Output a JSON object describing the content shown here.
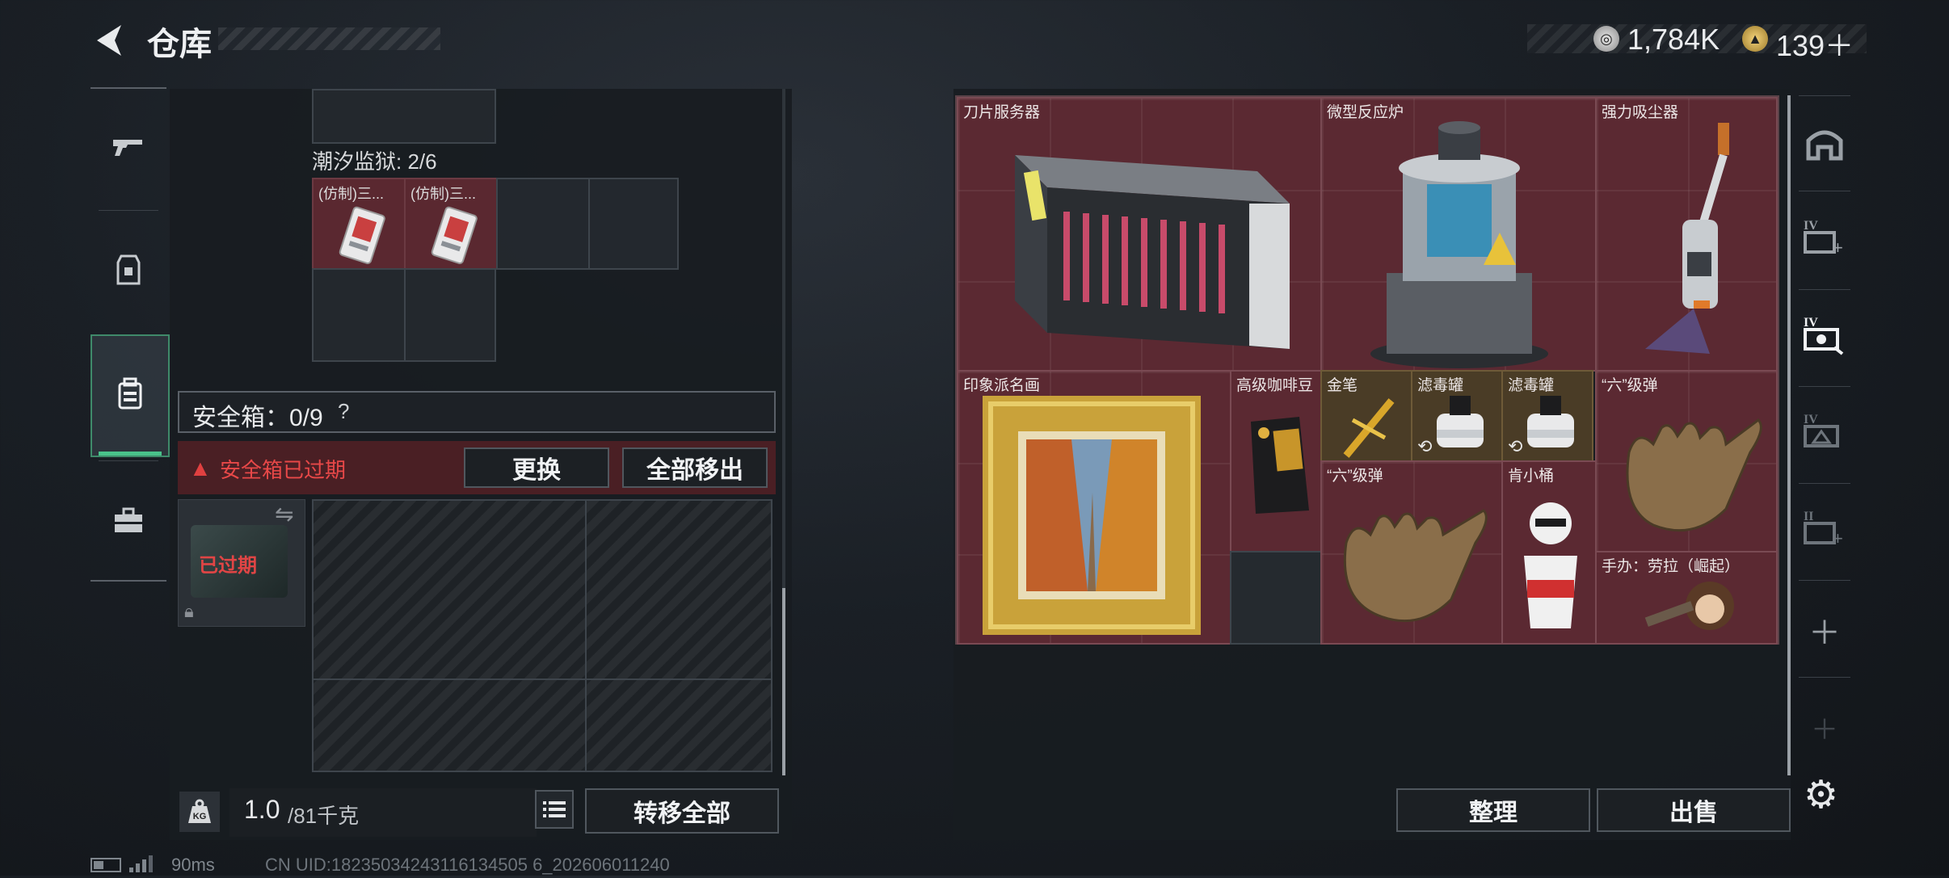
{
  "header": {
    "back_icon": "back-arrow-icon",
    "title": "仓库",
    "currency1": {
      "icon": "silver-coin-icon",
      "value": "1,784K"
    },
    "currency2": {
      "icon": "gold-coin-icon",
      "value": "139＋"
    }
  },
  "left_rail": {
    "tabs": [
      {
        "icon": "gun-icon",
        "active": false
      },
      {
        "icon": "armor-vest-icon",
        "active": false
      },
      {
        "icon": "backpack-icon",
        "active": true
      },
      {
        "icon": "toolbox-icon",
        "active": false
      }
    ]
  },
  "left_panel": {
    "prison_label": "潮汐监狱: 2/6",
    "prison_items": [
      {
        "caption": "(仿制)三...",
        "icon": "keycard-icon"
      },
      {
        "caption": "(仿制)三...",
        "icon": "keycard-icon"
      }
    ],
    "safe_box": {
      "label": "安全箱：0/9",
      "help": "?",
      "expired_text": "安全箱已过期",
      "replace_button": "更换",
      "move_all_button": "全部移出",
      "thumb_status": "已过期"
    },
    "weight": {
      "value": "1.0",
      "max": "/81千克",
      "icon": "weight-kg-icon"
    },
    "transfer_all_button": "转移全部"
  },
  "status_bar": {
    "ping": "90ms",
    "uid": "CN UID:18235034243116134505 6_202606011240"
  },
  "stash": {
    "items": [
      {
        "label": "刀片服务器",
        "art": "blade-server"
      },
      {
        "label": "微型反应炉",
        "art": "mini-reactor"
      },
      {
        "label": "强力吸尘器",
        "art": "vacuum"
      },
      {
        "label": "印象派名画",
        "art": "painting"
      },
      {
        "label": "高级咖啡豆",
        "art": "coffee"
      },
      {
        "label": "金笔",
        "art": "gold-pen"
      },
      {
        "label": "滤毒罐",
        "art": "filter"
      },
      {
        "label": "滤毒罐",
        "art": "filter"
      },
      {
        "label": "“六”级弹",
        "art": "glove"
      },
      {
        "label": "“六”级弹",
        "art": "glove"
      },
      {
        "label": "肯小桶",
        "art": "kfc"
      },
      {
        "label": "手办：劳拉（崛起）",
        "art": "figure"
      }
    ],
    "sort_button": "整理",
    "sell_button": "出售"
  },
  "right_rail": {
    "icons": [
      "safehouse-icon",
      "card-iv-plus-icon",
      "card-iv-active-icon",
      "ticket-iv-icon",
      "card-ii-plus-icon",
      "plus-icon",
      "plus-faded-icon"
    ],
    "settings_icon": "gear-icon"
  }
}
